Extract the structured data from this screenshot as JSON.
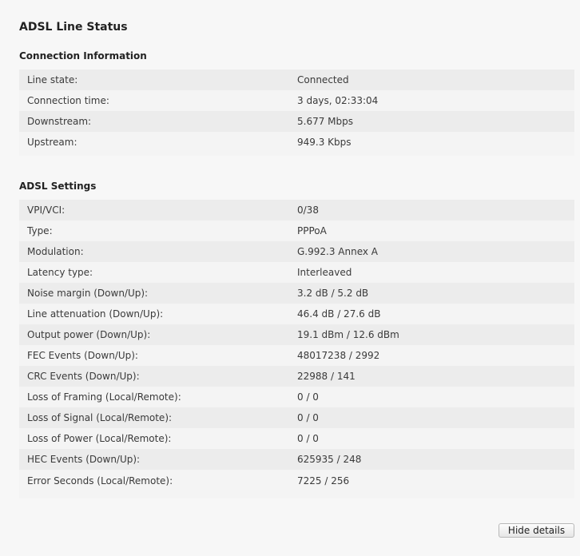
{
  "page": {
    "title": "ADSL Line Status"
  },
  "connection": {
    "heading": "Connection Information",
    "rows": [
      {
        "label": "Line state:",
        "value": "Connected"
      },
      {
        "label": "Connection time:",
        "value": "3 days, 02:33:04"
      },
      {
        "label": "Downstream:",
        "value": "5.677 Mbps"
      },
      {
        "label": "Upstream:",
        "value": "949.3 Kbps"
      }
    ]
  },
  "adsl": {
    "heading": "ADSL Settings",
    "rows": [
      {
        "label": "VPI/VCI:",
        "value": "0/38"
      },
      {
        "label": "Type:",
        "value": "PPPoA"
      },
      {
        "label": "Modulation:",
        "value": "G.992.3 Annex A"
      },
      {
        "label": "Latency type:",
        "value": "Interleaved"
      },
      {
        "label": "Noise margin (Down/Up):",
        "value": "3.2 dB / 5.2 dB"
      },
      {
        "label": "Line attenuation (Down/Up):",
        "value": "46.4 dB / 27.6 dB"
      },
      {
        "label": "Output power (Down/Up):",
        "value": "19.1 dBm / 12.6 dBm"
      },
      {
        "label": "FEC Events (Down/Up):",
        "value": "48017238 / 2992"
      },
      {
        "label": "CRC Events (Down/Up):",
        "value": "22988 / 141"
      },
      {
        "label": "Loss of Framing (Local/Remote):",
        "value": "0 / 0"
      },
      {
        "label": "Loss of Signal (Local/Remote):",
        "value": "0 / 0"
      },
      {
        "label": "Loss of Power (Local/Remote):",
        "value": "0 / 0"
      },
      {
        "label": "HEC Events (Down/Up):",
        "value": "625935 / 248"
      },
      {
        "label": "Error Seconds (Local/Remote):",
        "value": "7225 / 256"
      }
    ]
  },
  "actions": {
    "hide_details_label": "Hide details"
  }
}
